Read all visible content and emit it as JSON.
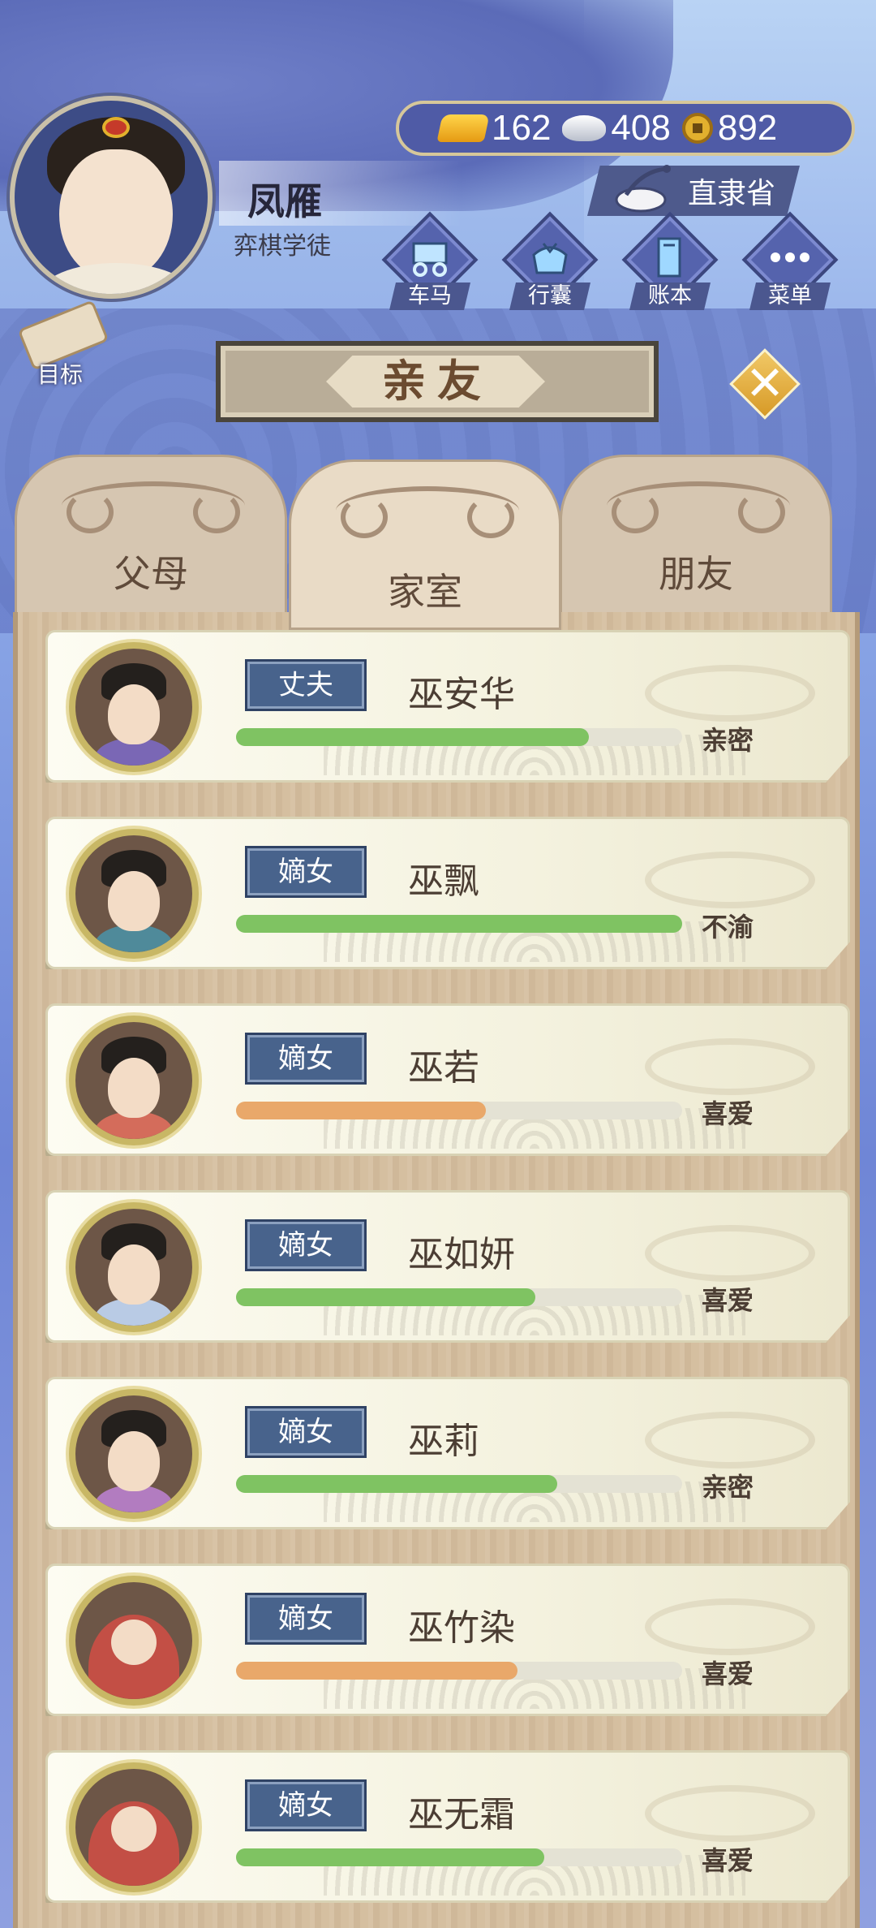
{
  "player": {
    "name": "凤雁",
    "title": "弈棋学徒"
  },
  "currency": {
    "gold": "162",
    "silver": "408",
    "coins": "892",
    "gold_icon": "gold-ingot-icon",
    "silver_icon": "silver-ingot-icon",
    "coin_icon": "copper-coin-icon"
  },
  "location": "直隶省",
  "nav": [
    {
      "label": "车马",
      "icon": "carriage-icon"
    },
    {
      "label": "行囊",
      "icon": "bundle-icon"
    },
    {
      "label": "账本",
      "icon": "ledger-icon"
    },
    {
      "label": "菜单",
      "icon": "more-dots-icon"
    }
  ],
  "goal": {
    "label": "目标",
    "icon": "scroll-icon"
  },
  "panel": {
    "title": "亲友",
    "close_icon": "close-icon"
  },
  "tabs": [
    {
      "label": "父母",
      "active": false
    },
    {
      "label": "家室",
      "active": true
    },
    {
      "label": "朋友",
      "active": false
    }
  ],
  "colors": {
    "bar_green": "#7fc362",
    "bar_orange": "#e9a86a",
    "tag_blue": "#48638c"
  },
  "members": [
    {
      "role": "丈夫",
      "name": "巫安华",
      "status": "亲密",
      "affection": 0.79,
      "bar_color": "green",
      "portrait": "boy",
      "robe": "#7a67b5"
    },
    {
      "role": "嫡女",
      "name": "巫飘",
      "status": "不渝",
      "affection": 1.0,
      "bar_color": "green",
      "portrait": "girl",
      "robe": "#4f8a9a"
    },
    {
      "role": "嫡女",
      "name": "巫若",
      "status": "喜爱",
      "affection": 0.56,
      "bar_color": "orange",
      "portrait": "girl",
      "robe": "#d46c5b"
    },
    {
      "role": "嫡女",
      "name": "巫如妍",
      "status": "喜爱",
      "affection": 0.67,
      "bar_color": "green",
      "portrait": "girl",
      "robe": "#b9cbe5"
    },
    {
      "role": "嫡女",
      "name": "巫莉",
      "status": "亲密",
      "affection": 0.72,
      "bar_color": "green",
      "portrait": "girl",
      "robe": "#b27cc0"
    },
    {
      "role": "嫡女",
      "name": "巫竹染",
      "status": "喜爱",
      "affection": 0.63,
      "bar_color": "orange",
      "portrait": "baby",
      "robe": "#c34f45"
    },
    {
      "role": "嫡女",
      "name": "巫无霜",
      "status": "喜爱",
      "affection": 0.69,
      "bar_color": "green",
      "portrait": "baby",
      "robe": "#c34f45"
    }
  ]
}
